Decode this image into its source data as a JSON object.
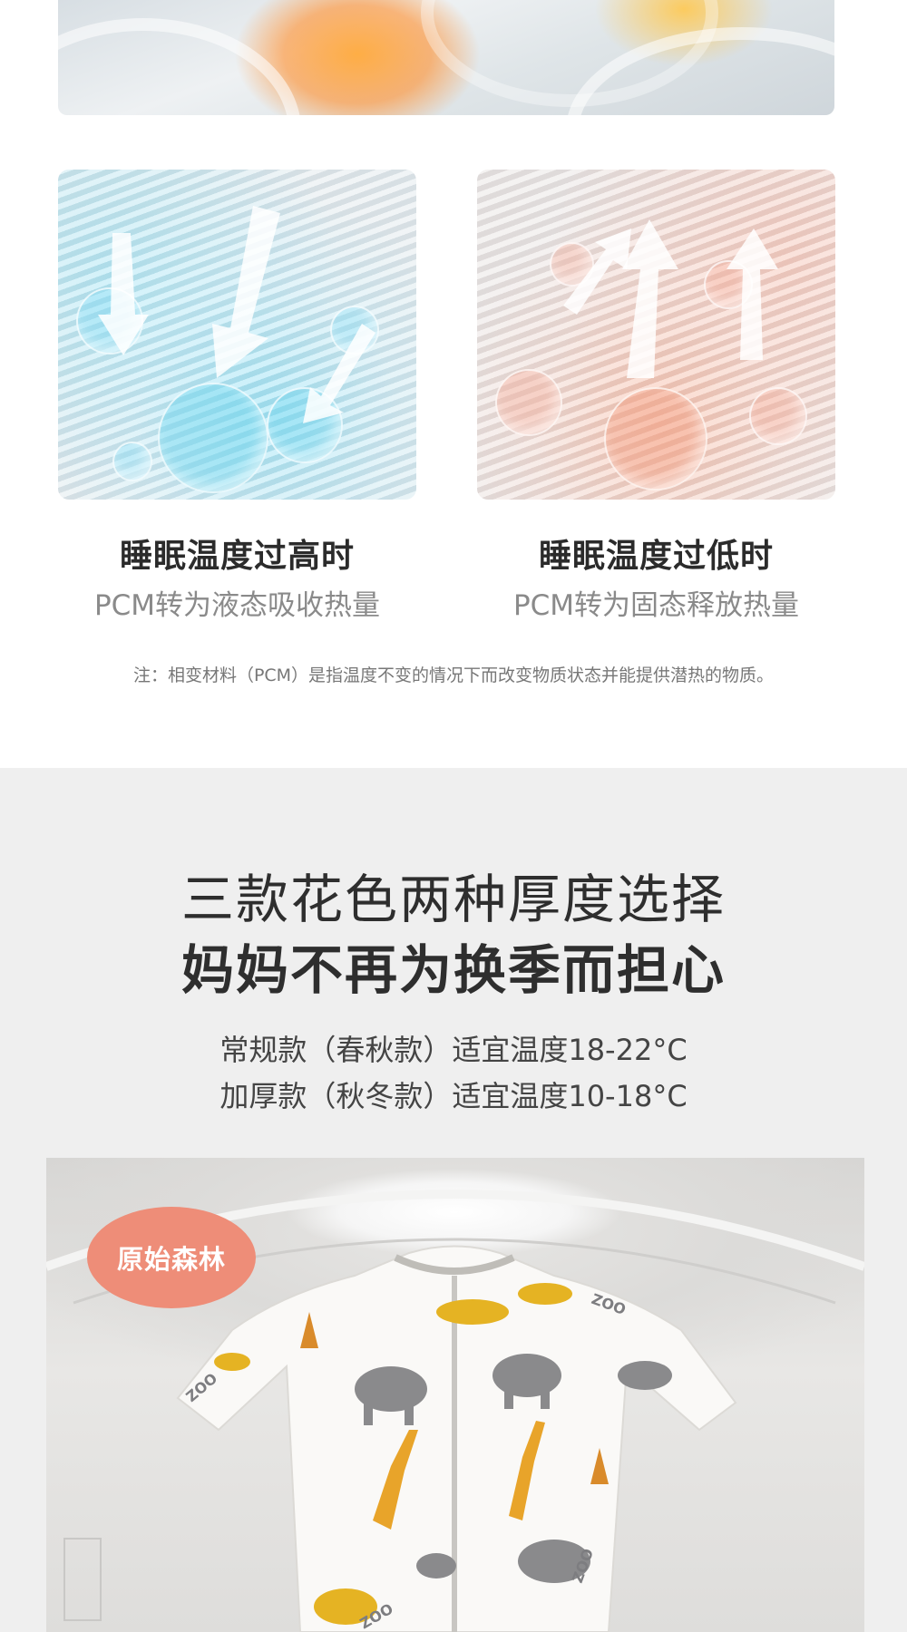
{
  "cards": [
    {
      "title": "睡眠温度过高时",
      "subtitle": "PCM转为液态吸收热量",
      "theme": "cool",
      "accent": "#7fd8f0"
    },
    {
      "title": "睡眠温度过低时",
      "subtitle": "PCM转为固态释放热量",
      "theme": "warm",
      "accent": "#f5a48c"
    }
  ],
  "note": "注：相变材料（PCM）是指温度不变的情况下而改变物质状态并能提供潜热的物质。",
  "section": {
    "headline_line1": "三款花色两种厚度选择",
    "headline_line2": "妈妈不再为换季而担心",
    "spec_regular": "常规款（春秋款）适宜温度18-22°C",
    "spec_thick": "加厚款（秋冬款）适宜温度10-18°C"
  },
  "product": {
    "tag": "原始森林",
    "tag_color": "#ee8d78",
    "print_text": "ZOO"
  },
  "colors": {
    "background_section": "#efefef",
    "headline": "#2e2e2e",
    "subtitle_gray": "#8a8a8a"
  }
}
